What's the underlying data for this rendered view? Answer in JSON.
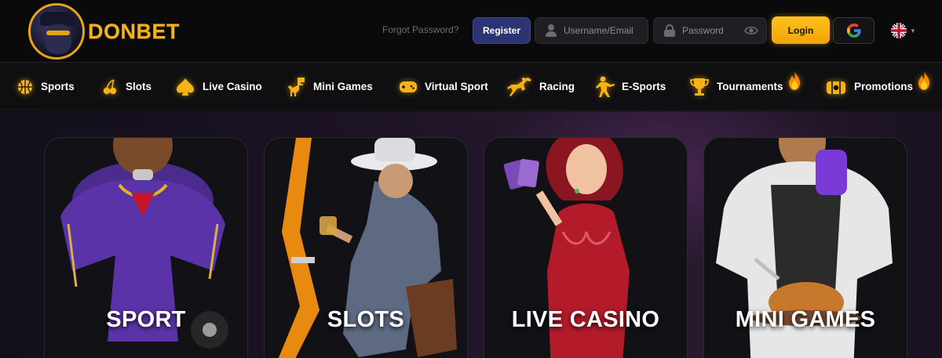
{
  "brand": {
    "name": "DONBET"
  },
  "auth": {
    "forgot_password": "Forgot Password?",
    "register": "Register",
    "username_placeholder": "Username/Email",
    "password_placeholder": "Password",
    "login": "Login",
    "google_icon": "google-icon",
    "language_icon": "uk-flag-icon"
  },
  "nav": {
    "items": [
      {
        "label": "Sports",
        "icon": "basketball-icon"
      },
      {
        "label": "Slots",
        "icon": "cherry-icon"
      },
      {
        "label": "Live Casino",
        "icon": "spade-icon"
      },
      {
        "label": "Mini Games",
        "icon": "dino-icon"
      },
      {
        "label": "Virtual Sport",
        "icon": "gamepad-icon"
      },
      {
        "label": "Racing",
        "icon": "horse-icon"
      },
      {
        "label": "E-Sports",
        "icon": "soldier-icon"
      },
      {
        "label": "Tournaments",
        "icon": "trophy-icon",
        "hot": true
      },
      {
        "label": "Promotions",
        "icon": "gift-icon",
        "hot": true
      }
    ]
  },
  "categories": [
    {
      "title": "SPORT"
    },
    {
      "title": "SLOTS"
    },
    {
      "title": "LIVE CASINO"
    },
    {
      "title": "MINI GAMES"
    }
  ],
  "colors": {
    "accent": "#f2b31c",
    "register": "#2d3474",
    "background": "#0b0b0d"
  }
}
